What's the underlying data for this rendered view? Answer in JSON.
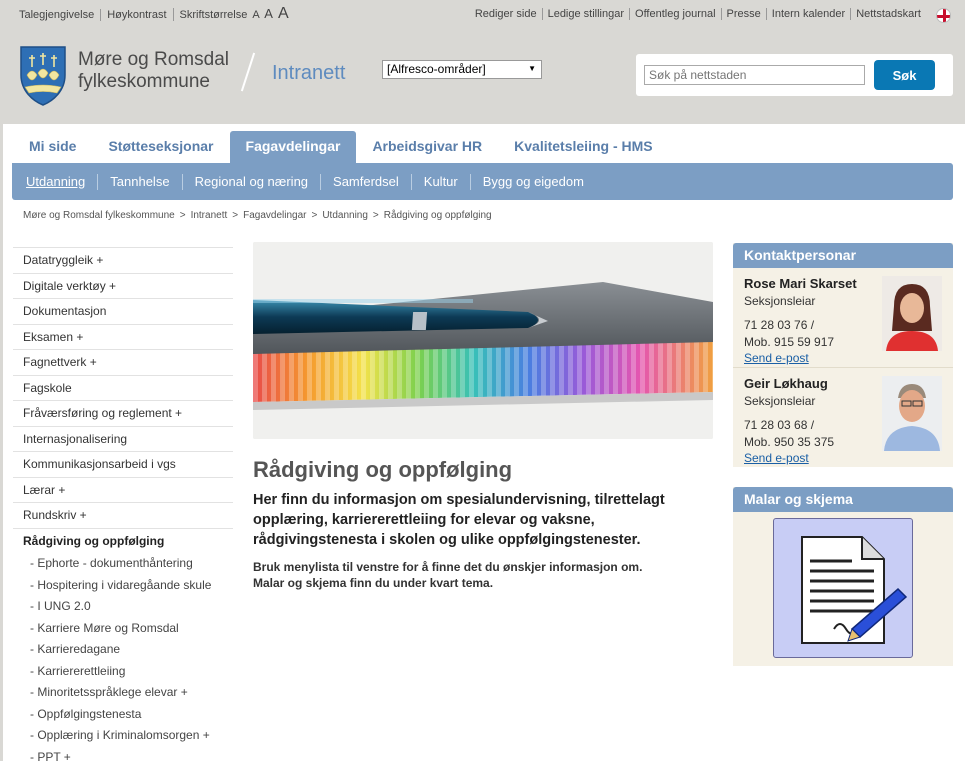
{
  "utility": {
    "left": [
      "Talegjengivelse",
      "Høykontrast",
      "Skriftstørrelse"
    ],
    "font_sizes": [
      "A",
      "A",
      "A"
    ],
    "right": [
      "Rediger side",
      "Ledige stillingar",
      "Offentleg journal",
      "Presse",
      "Intern kalender",
      "Nettstadskart"
    ]
  },
  "header": {
    "org_line1": "Møre og Romsdal",
    "org_line2": "fylkeskommune",
    "site": "Intranett",
    "select_value": "[Alfresco-områder]",
    "search_placeholder": "Søk på nettstaden",
    "search_button": "Søk"
  },
  "tabs": [
    "Mi side",
    "Støtteseksjonar",
    "Fagavdelingar",
    "Arbeidsgivar HR",
    "Kvalitetsleiing - HMS"
  ],
  "active_tab": "Fagavdelingar",
  "subnav": [
    "Utdanning",
    "Tannhelse",
    "Regional og næring",
    "Samferdsel",
    "Kultur",
    "Bygg og eigedom"
  ],
  "active_subnav": "Utdanning",
  "breadcrumb": [
    "Møre og Romsdal fylkeskommune",
    "Intranett",
    "Fagavdelingar",
    "Utdanning",
    "Rådgiving og oppfølging"
  ],
  "leftnav": {
    "items": [
      "Datatryggleik +",
      "Digitale verktøy +",
      "Dokumentasjon",
      "Eksamen +",
      "Fagnettverk +",
      "Fagskole",
      "Fråværsføring og reglement +",
      "Internasjonalisering",
      "Kommunikasjonsarbeid i vgs",
      "Lærar +",
      "Rundskriv +"
    ],
    "active": "Rådgiving og oppfølging",
    "subitems": [
      "- Ephorte - dokumenthåntering",
      "- Hospitering i vidaregåande skule",
      "- I UNG 2.0",
      "- Karriere Møre og Romsdal",
      "- Karrieredagane",
      "- Karriererettleiing",
      "- Minoritetsspråklege elevar +",
      "- Oppfølgingstenesta",
      "- Opplæring i Kriminalomsorgen +",
      "- PPT +"
    ]
  },
  "content": {
    "title": "Rådgiving og oppfølging",
    "lead": "Her finn du informasjon om spesialundervisning, tilrettelagt opplæring, karriererettleiing for elevar og vaksne, rådgivingstenesta i skolen og ulike oppfølgingstenester.",
    "body_line1": "Bruk menylista til venstre for å finne det du ønskjer informasjon om.",
    "body_line2": "Malar og skjema finn du under kvart tema."
  },
  "sidebar": {
    "contacts_title": "Kontaktpersonar",
    "contacts": [
      {
        "name": "Rose Mari Skarset",
        "role": "Seksjonsleiar",
        "phone": "71 28 03 76 /",
        "mobile": "Mob. 915 59 917",
        "email_label": "Send e-post"
      },
      {
        "name": "Geir Løkhaug",
        "role": "Seksjonsleiar",
        "phone": "71 28 03 68 /",
        "mobile": "Mob. 950 35 375",
        "email_label": "Send e-post"
      }
    ],
    "forms_title": "Malar og skjema"
  },
  "colors": {
    "accent": "#7c9ec4",
    "brand_blue": "#0a78b4",
    "link": "#1a5fa5",
    "background": "#d9d8d4"
  }
}
